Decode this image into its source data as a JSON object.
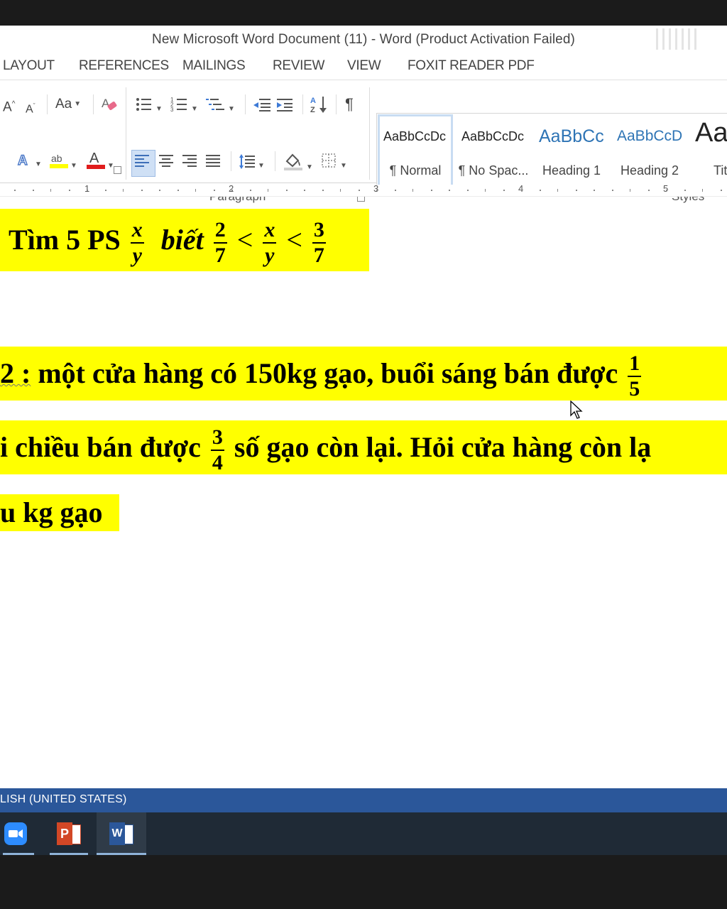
{
  "window": {
    "title": "New Microsoft Word Document (11) - Word (Product Activation Failed)"
  },
  "tabs": [
    "LAYOUT",
    "REFERENCES",
    "MAILINGS",
    "REVIEW",
    "VIEW",
    "FOXIT READER PDF"
  ],
  "ribbon": {
    "paragraph_label": "Paragraph",
    "styles_label": "Styles",
    "font_grow": "A",
    "font_shrink": "A",
    "change_case": "Aa",
    "sort_icon": "sort-az-icon",
    "pilcrow": "¶",
    "font_color_letter": "A",
    "highlight_letters": "ab",
    "styles": [
      {
        "sample": "AaBbCcDc",
        "name": "¶ Normal"
      },
      {
        "sample": "AaBbCcDc",
        "name": "¶ No Spac..."
      },
      {
        "sample": "AaBbCc",
        "name": "Heading 1"
      },
      {
        "sample": "AaBbCcD",
        "name": "Heading 2"
      },
      {
        "sample": "Aa",
        "name": "Tit"
      }
    ]
  },
  "ruler": {
    "numbers": [
      "1",
      "2",
      "3",
      "4",
      "5"
    ]
  },
  "document": {
    "line1": {
      "prefix": "Tìm 5 PS",
      "frac1": [
        "x",
        "y"
      ],
      "word": "biết",
      "frac2": [
        "2",
        "7"
      ],
      "lt1": "<",
      "frac3": [
        "x",
        "y"
      ],
      "lt2": "<",
      "frac4": [
        "3",
        "7"
      ]
    },
    "line2": {
      "prefix": "2 :",
      "text": " một cửa hàng có 150kg gạo, buổi sáng bán được",
      "frac": [
        "1",
        "5"
      ]
    },
    "line3": {
      "text1": "i chiều bán được",
      "frac": [
        "3",
        "4"
      ],
      "text2": " số gạo còn lại. Hỏi cửa hàng còn lạ"
    },
    "line4": {
      "text": "u kg gạo"
    }
  },
  "status": {
    "language": "LISH (UNITED STATES)"
  },
  "taskbar": {
    "items": [
      {
        "name": "zoom-icon"
      },
      {
        "name": "powerpoint-icon",
        "letter": "P"
      },
      {
        "name": "word-icon",
        "letter": "W"
      }
    ]
  },
  "colors": {
    "highlight": "#ffff00",
    "statusbar": "#2b579a",
    "taskbar": "#1f2a36",
    "zoom": "#2d8cff",
    "powerpoint": "#d24726",
    "word": "#2b579a"
  }
}
